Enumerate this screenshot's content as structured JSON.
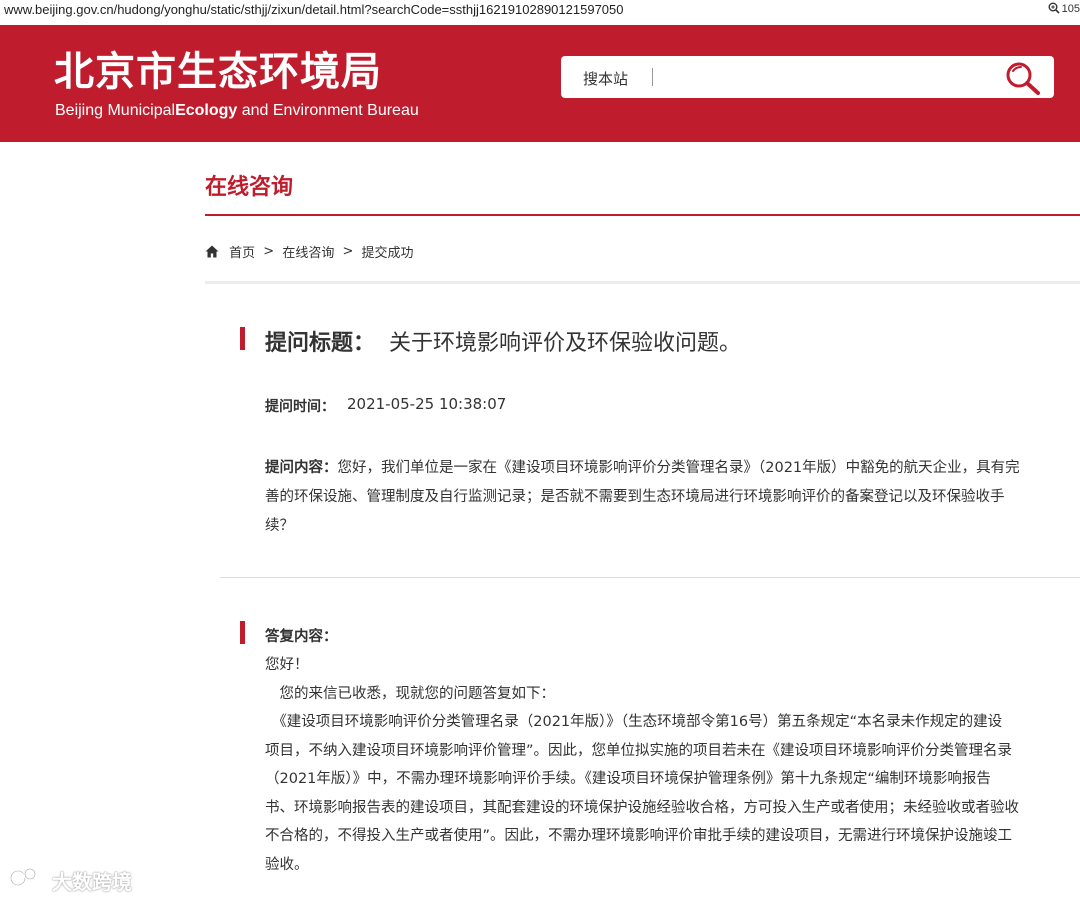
{
  "browser": {
    "url": "www.beijing.gov.cn/hudong/yonghu/static/sthjj/zixun/detail.html?searchCode=ssthjj16219102890121597050",
    "zoom": "105"
  },
  "header": {
    "title_cn": "北京市生态环境局",
    "subtitle_part1": "Beijing Municipal",
    "subtitle_part2": "Ecology",
    "subtitle_part3": " and Environment Bureau",
    "search_label": "搜本站",
    "search_value": "",
    "brand_color": "#bf1d2d"
  },
  "section": {
    "title": "在线咨询"
  },
  "breadcrumb": {
    "home": "首页",
    "sep": ">",
    "item1": "在线咨询",
    "item2": "提交成功"
  },
  "question": {
    "title_label": "提问标题：",
    "title": "关于环境影响评价及环保验收问题。",
    "time_label": "提问时间：",
    "time": "2021-05-25 10:38:07",
    "content_label": "提问内容：",
    "content_line1": "您好，我们单位是一家在《建设项目环境影响评价分类管理名录》（2021年版）中豁免的航天企业，具有完",
    "content_line2": "善的环保设施、管理制度及自行监测记录；是否就不需要到生态环境局进行环境影响评价的备案登记以及环保验收手",
    "content_line3": "续？"
  },
  "answer": {
    "label": "答复内容：",
    "lines": [
      "您好！",
      "　您的来信已收悉，现就您的问题答复如下：",
      "　《建设项目环境影响评价分类管理名录（2021年版）》（生态环境部令第16号）第五条规定“本名录未作规定的建设",
      "项目，不纳入建设项目环境影响评价管理”。因此，您单位拟实施的项目若未在《建设项目环境影响评价分类管理名录",
      "（2021年版）》中，不需办理环境影响评价手续。《建设项目环境保护管理条例》第十九条规定“编制环境影响报告",
      "书、环境影响报告表的建设项目，其配套建设的环境保护设施经验收合格，方可投入生产或者使用；未经验收或者验收",
      "不合格的，不得投入生产或者使用”。因此，不需办理环境影响评价审批手续的建设项目，无需进行环境保护设施竣工",
      "验收。"
    ]
  },
  "watermark": {
    "text": "大数跨境"
  }
}
